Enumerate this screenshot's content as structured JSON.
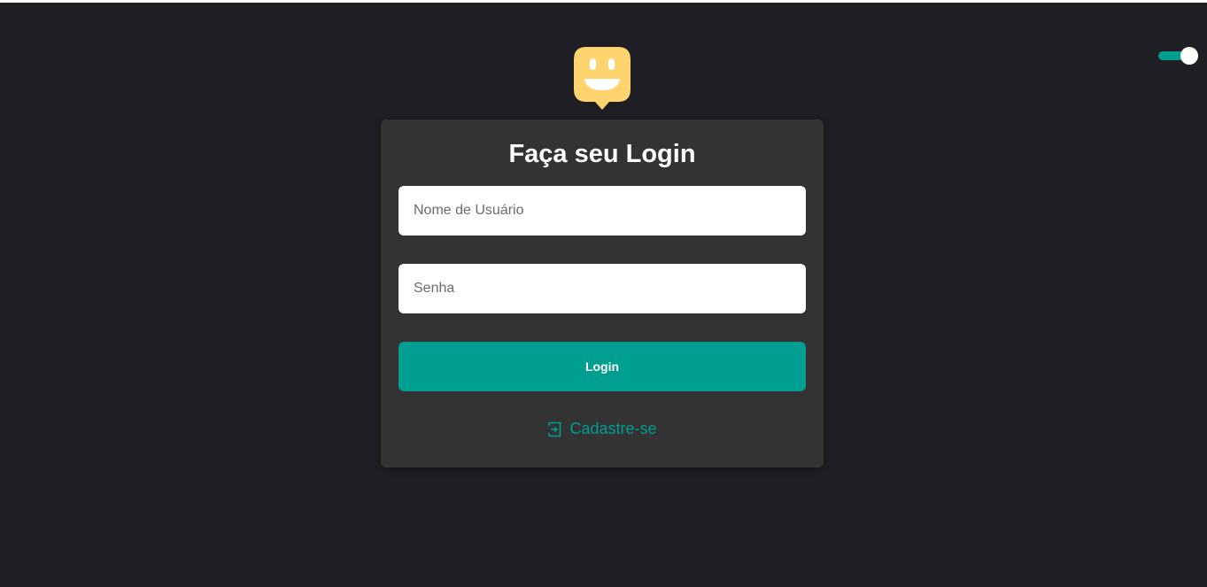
{
  "colors": {
    "accent": "#009e90",
    "logo_yellow": "#ffd36e",
    "background": "#1f1e24",
    "card": "#333333"
  },
  "theme_toggle": {
    "state": "on"
  },
  "logo": {
    "icon": "smiley-chat-bubble-icon"
  },
  "login_form": {
    "title": "Faça seu Login",
    "username_placeholder": "Nome de Usuário",
    "password_placeholder": "Senha",
    "submit_label": "Login"
  },
  "register": {
    "icon": "sign-in-door-icon",
    "label": "Cadastre-se"
  }
}
